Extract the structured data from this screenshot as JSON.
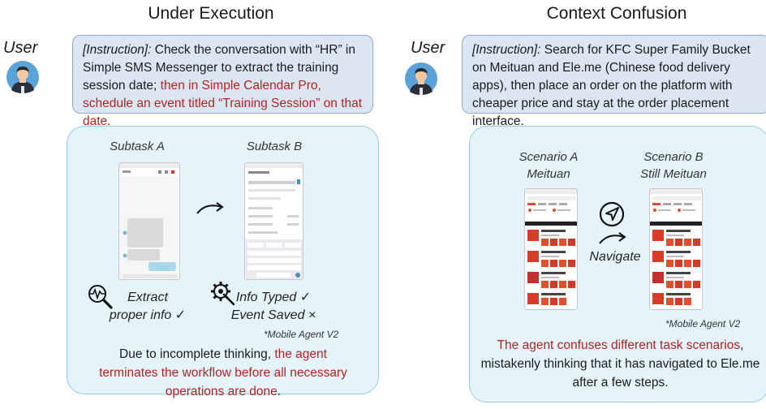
{
  "left": {
    "title": "Under Execution",
    "user_label": "User",
    "instruction": {
      "prefix": "[Instruction]:",
      "black": " Check the conversation with “HR” in Simple SMS Messenger to extract the training session date; ",
      "red": "then in Simple Calendar Pro, schedule an event titled “Training Session” on that date."
    },
    "subtask_a": "Subtask A",
    "subtask_b": "Subtask B",
    "caption_a": {
      "line1": "Extract",
      "line2": "proper info ✓"
    },
    "caption_b": {
      "line1": "Info Typed ✓",
      "line2": "Event Saved ×"
    },
    "note": "*Mobile Agent V2",
    "explanation": {
      "black1": "Due to incomplete thinking, ",
      "red": "the agent terminates the workflow before all necessary operations are done",
      "black2": "."
    },
    "icons": [
      "magnifier-pulse-icon",
      "gear-wrench-icon",
      "curved-arrow-icon"
    ]
  },
  "right": {
    "title": "Context Confusion",
    "user_label": "User",
    "instruction": {
      "prefix": "[Instruction]:",
      "black": " Search for KFC Super Family Bucket on Meituan and Ele.me (Chinese food delivery apps), then place an order on the platform with cheaper price and stay at the order placement interface."
    },
    "scenario_a": {
      "line1": "Scenario A",
      "line2": "Meituan"
    },
    "scenario_b": {
      "line1": "Scenario B",
      "line2": "Still Meituan"
    },
    "navigate_label": "Navigate",
    "note": "*Mobile Agent V2",
    "explanation": {
      "red": "The agent confuses different task scenarios",
      "black1": ", mistakenly thinking that it has navigated to ",
      "black2": "Ele.me",
      "black3": " after a few steps."
    },
    "icons": [
      "navigate-icon",
      "curved-arrow-icon"
    ]
  },
  "colors": {
    "accent_red": "#b22222",
    "instruction_bg": "#dce6f2",
    "panel_bg": "#e4f4fa"
  }
}
